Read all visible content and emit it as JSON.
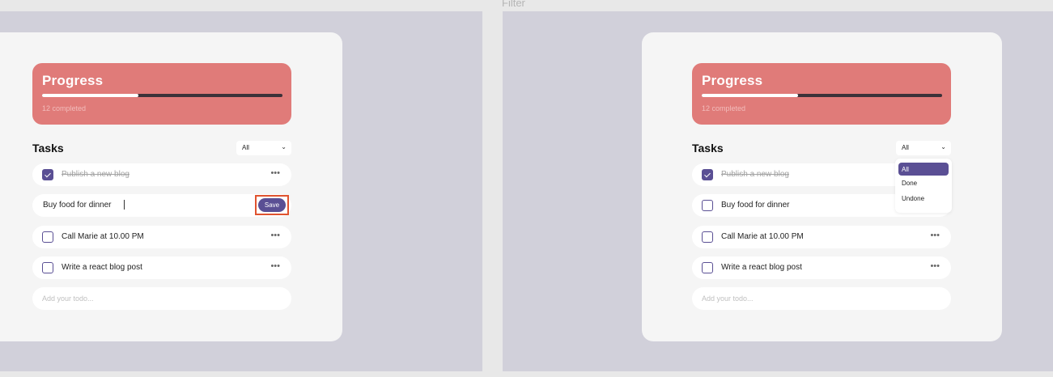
{
  "caption": "Filter",
  "screens": [
    {
      "progress": {
        "title": "Progress",
        "subtitle": "12 completed",
        "fraction": 0.4
      },
      "tasks_title": "Tasks",
      "filter": {
        "selected": "All"
      },
      "tasks": [
        {
          "text": "Publish a new blog",
          "done": true
        },
        {
          "text": "Buy food for dinner",
          "editing": true
        },
        {
          "text": "Call Marie at 10.00 PM",
          "done": false
        },
        {
          "text": "Write a react blog post",
          "done": false
        }
      ],
      "save_label": "Save",
      "add_placeholder": "Add your todo..."
    },
    {
      "progress": {
        "title": "Progress",
        "subtitle": "12 completed",
        "fraction": 0.4
      },
      "tasks_title": "Tasks",
      "filter": {
        "selected": "All",
        "options": [
          "All",
          "Done",
          "Undone"
        ]
      },
      "tasks": [
        {
          "text": "Publish a new blog",
          "done": true
        },
        {
          "text": "Buy food for dinner",
          "done": false
        },
        {
          "text": "Call Marie at 10.00 PM",
          "done": false
        },
        {
          "text": "Write a react blog post",
          "done": false
        }
      ],
      "add_placeholder": "Add your todo..."
    }
  ],
  "icons": {
    "checkbox": "checkbox-icon",
    "more": "more-dots-icon",
    "chevron": "chevron-down-icon"
  },
  "colors": {
    "accent": "#5a4f94",
    "progress_bg": "#e07b79",
    "highlight": "#e0532f"
  }
}
